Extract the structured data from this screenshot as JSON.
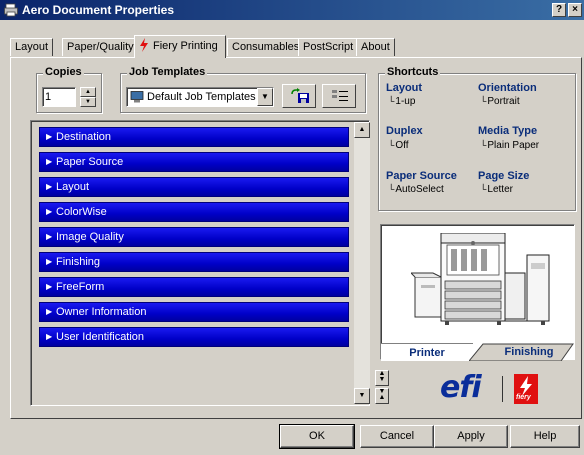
{
  "window": {
    "title": "Aero Document Properties",
    "help_button": "?",
    "close_button": "×"
  },
  "tabs": [
    {
      "label": "Layout"
    },
    {
      "label": "Paper/Quality"
    },
    {
      "label": "Fiery Printing",
      "active": true
    },
    {
      "label": "Consumables"
    },
    {
      "label": "PostScript"
    },
    {
      "label": "About"
    }
  ],
  "copies": {
    "label": "Copies",
    "value": "1"
  },
  "job_templates": {
    "label": "Job Templates",
    "selected": "Default Job Templates"
  },
  "sections": [
    {
      "label": "Destination"
    },
    {
      "label": "Paper Source"
    },
    {
      "label": "Layout"
    },
    {
      "label": "ColorWise"
    },
    {
      "label": "Image Quality"
    },
    {
      "label": "Finishing"
    },
    {
      "label": "FreeForm"
    },
    {
      "label": "Owner Information"
    },
    {
      "label": "User Identification"
    }
  ],
  "shortcuts": {
    "label": "Shortcuts",
    "items": [
      {
        "name": "Layout",
        "value": "1-up"
      },
      {
        "name": "Orientation",
        "value": "Portrait"
      },
      {
        "name": "Duplex",
        "value": "Off"
      },
      {
        "name": "Media Type",
        "value": "Plain Paper"
      },
      {
        "name": "Paper Source",
        "value": "AutoSelect"
      },
      {
        "name": "Page Size",
        "value": "Letter"
      }
    ]
  },
  "printer_view": {
    "tab_printer": "Printer",
    "tab_finishing": "Finishing"
  },
  "logos": {
    "efi": "efi",
    "fiery": "fiery"
  },
  "buttons": {
    "ok": "OK",
    "cancel": "Cancel",
    "apply": "Apply",
    "help": "Help"
  },
  "colors": {
    "titlebar": "#0a246a",
    "section_bar": "#0000c8",
    "shortcut_heading": "#0a2d7a",
    "efi_blue": "#0a2d9a",
    "fiery_red": "#e01010"
  }
}
